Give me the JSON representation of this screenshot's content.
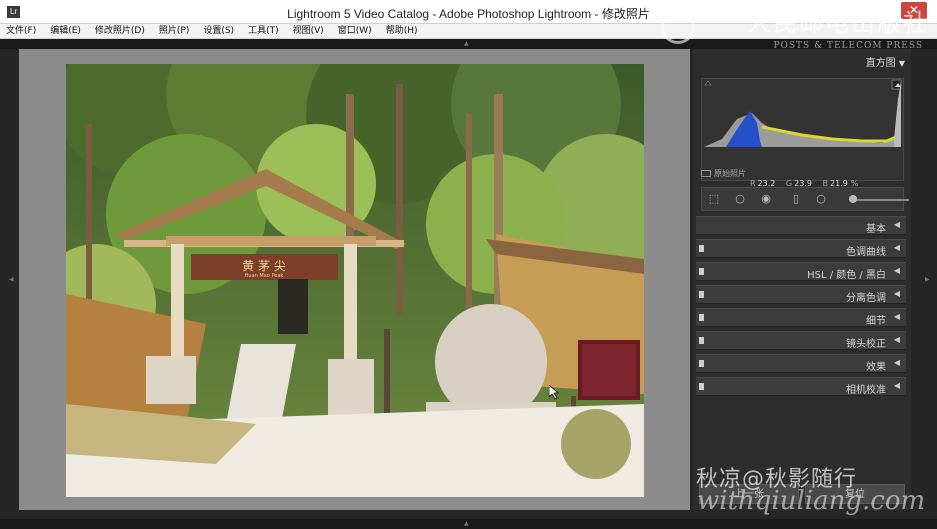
{
  "window": {
    "title": "Lightroom 5 Video Catalog - Adobe Photoshop Lightroom - 修改照片",
    "icon_label": "Lr",
    "close_label": "✕"
  },
  "menu": [
    "文件(F)",
    "编辑(E)",
    "修改照片(D)",
    "照片(P)",
    "设置(S)",
    "工具(T)",
    "视图(V)",
    "窗口(W)",
    "帮助(H)"
  ],
  "photo": {
    "sign_chinese": "黄 茅 尖",
    "sign_pinyin": "Huan  Mao  Peak"
  },
  "right_panel": {
    "histogram": {
      "title": "直方图",
      "r_label": "R",
      "r_value": "23.2",
      "g_label": "G",
      "g_value": "23.9",
      "b_label": "B",
      "b_value": "21.9",
      "unit": "%",
      "original_label": "原始照片"
    },
    "sections": [
      {
        "label": "基本",
        "has_switch": false
      },
      {
        "label": "色调曲线",
        "has_switch": true
      },
      {
        "label": "HSL  /  颜色  /  黑白",
        "has_switch": true
      },
      {
        "label": "分离色调",
        "has_switch": true
      },
      {
        "label": "细节",
        "has_switch": true
      },
      {
        "label": "镜头校正",
        "has_switch": true
      },
      {
        "label": "效果",
        "has_switch": true
      },
      {
        "label": "相机校准",
        "has_switch": true
      }
    ],
    "buttons": {
      "previous": "上一张",
      "reset": "复位"
    }
  },
  "watermarks": {
    "publisher_cn": "人民邮电出版社",
    "publisher_en": "POSTS & TELECOM PRESS",
    "author": "秋凉@秋影随行",
    "site": "withqiuliang.com"
  }
}
